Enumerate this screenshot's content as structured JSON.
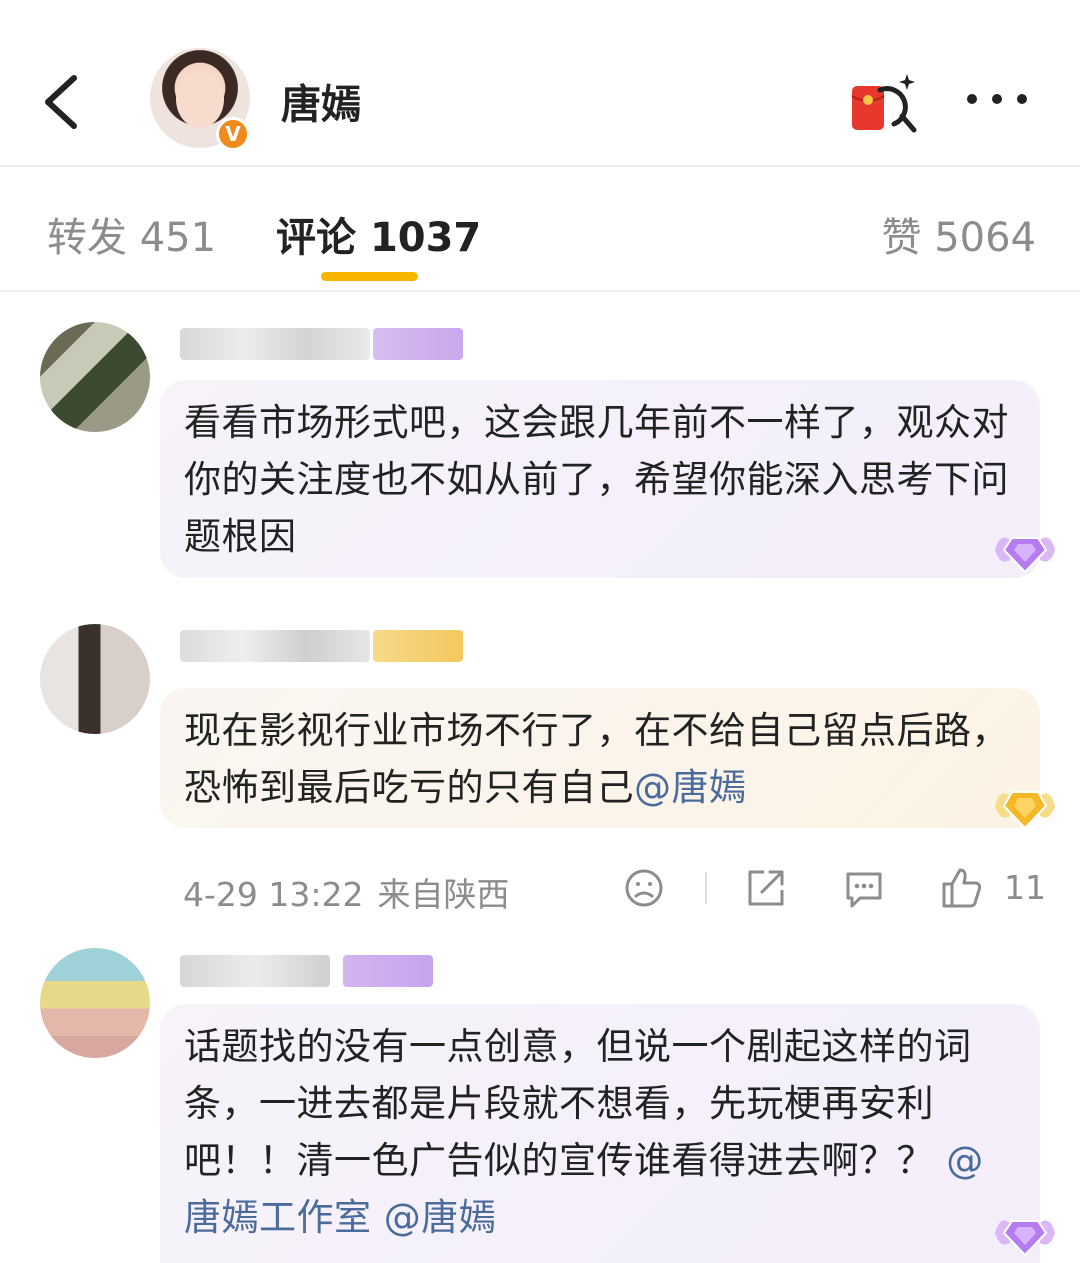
{
  "header": {
    "user_name": "唐嫣",
    "verified_badge": "V",
    "icons": [
      "back-arrow-icon",
      "red-packet-icon",
      "more-icon"
    ]
  },
  "tabs": [
    {
      "label": "转发",
      "count": "451"
    },
    {
      "label": "评论",
      "count": "1037"
    },
    {
      "label": "赞",
      "count": "5064"
    }
  ],
  "comments": [
    {
      "text": "看看市场形式吧，这会跟几年前不一样了，观众对你的关注度也不如从前了，希望你能深入思考下问题根因",
      "mentions": [],
      "badge": "purple-diamond-icon"
    },
    {
      "text": "现在影视行业市场不行了，在不给自己留点后路，恐怖到最后吃亏的只有自己",
      "mentions": [
        "@唐嫣"
      ],
      "badge": "gold-diamond-icon",
      "date": "4-29 13:22",
      "location": "来自陕西",
      "like_count": "11",
      "actions": [
        "dislike-face-icon",
        "share-icon",
        "reply-icon",
        "like-icon"
      ]
    },
    {
      "text": "话题找的没有一点创意，但说一个剧起这样的词条，一进去都是片段就不想看，先玩梗再安利吧！！清一色广告似的宣传谁看得进去啊？？",
      "mentions": [
        "@唐嫣工作室",
        "@唐嫣"
      ],
      "badge": "purple-diamond-icon"
    }
  ],
  "colors": {
    "accent": "#f7b500",
    "mention": "#4a6b9c",
    "muted": "#8c8c8c",
    "bubble_purple": "#f6f0fb",
    "bubble_gold": "#fcf5e8"
  }
}
